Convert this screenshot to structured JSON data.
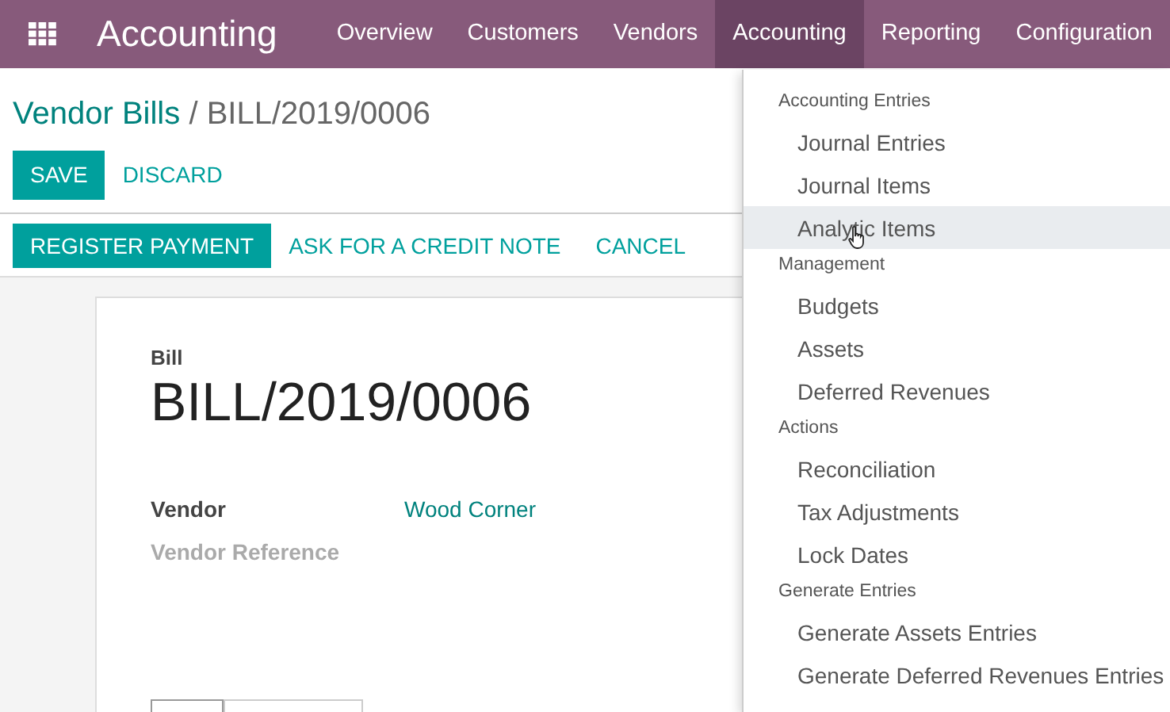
{
  "navbar": {
    "app_title": "Accounting",
    "menus": [
      {
        "label": "Overview",
        "selected": false
      },
      {
        "label": "Customers",
        "selected": false
      },
      {
        "label": "Vendors",
        "selected": false
      },
      {
        "label": "Accounting",
        "selected": true
      },
      {
        "label": "Reporting",
        "selected": false
      },
      {
        "label": "Configuration",
        "selected": false
      }
    ]
  },
  "breadcrumb": {
    "parent": "Vendor Bills",
    "separator": "/",
    "current": "BILL/2019/0006"
  },
  "edit_buttons": [
    {
      "label": "SAVE",
      "kind": "primary"
    },
    {
      "label": "DISCARD",
      "kind": "link"
    }
  ],
  "action_buttons": [
    {
      "label": "REGISTER PAYMENT",
      "kind": "primary"
    },
    {
      "label": "ASK FOR A CREDIT NOTE",
      "kind": "link"
    },
    {
      "label": "CANCEL",
      "kind": "link"
    }
  ],
  "sheet": {
    "type_label": "Bill",
    "title": "BILL/2019/0006",
    "fields": [
      {
        "label": "Vendor",
        "value": "Wood Corner",
        "empty": false
      },
      {
        "label": "Vendor Reference",
        "empty": true
      }
    ],
    "notebook_tabs": [
      {
        "selected": true
      },
      {
        "selected": false
      }
    ]
  },
  "dropdown": {
    "sections": [
      {
        "header": "Accounting Entries",
        "items": [
          {
            "label": "Journal Entries",
            "hovered": false
          },
          {
            "label": "Journal Items",
            "hovered": false
          },
          {
            "label": "Analytic Items",
            "hovered": true
          }
        ]
      },
      {
        "header": "Management",
        "items": [
          {
            "label": "Budgets",
            "hovered": false
          },
          {
            "label": "Assets",
            "hovered": false
          },
          {
            "label": "Deferred Revenues",
            "hovered": false
          }
        ]
      },
      {
        "header": "Actions",
        "items": [
          {
            "label": "Reconciliation",
            "hovered": false
          },
          {
            "label": "Tax Adjustments",
            "hovered": false
          },
          {
            "label": "Lock Dates",
            "hovered": false
          }
        ]
      },
      {
        "header": "Generate Entries",
        "items": [
          {
            "label": "Generate Assets Entries",
            "hovered": false
          },
          {
            "label": "Generate Deferred Revenues Entries",
            "hovered": false
          }
        ]
      }
    ]
  }
}
